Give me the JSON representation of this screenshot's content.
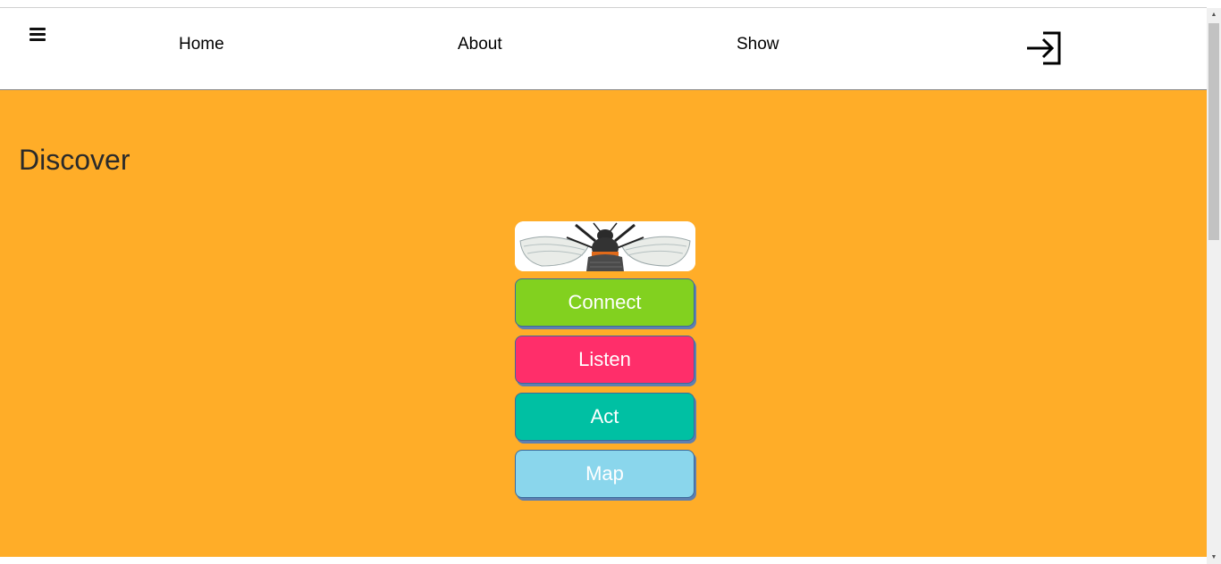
{
  "nav": {
    "menu_icon": "hamburger-menu-icon",
    "links": [
      {
        "label": "Home"
      },
      {
        "label": "About"
      },
      {
        "label": "Show"
      }
    ],
    "login_icon": "login-icon"
  },
  "main": {
    "heading": "Discover",
    "logo_icon": "bee-illustration",
    "buttons": [
      {
        "label": "Connect",
        "color": "#82d11f"
      },
      {
        "label": "Listen",
        "color": "#ff2e6a"
      },
      {
        "label": "Act",
        "color": "#00c0a3"
      },
      {
        "label": "Map",
        "color": "#8ad6ec"
      }
    ],
    "background_color": "#ffad28"
  }
}
